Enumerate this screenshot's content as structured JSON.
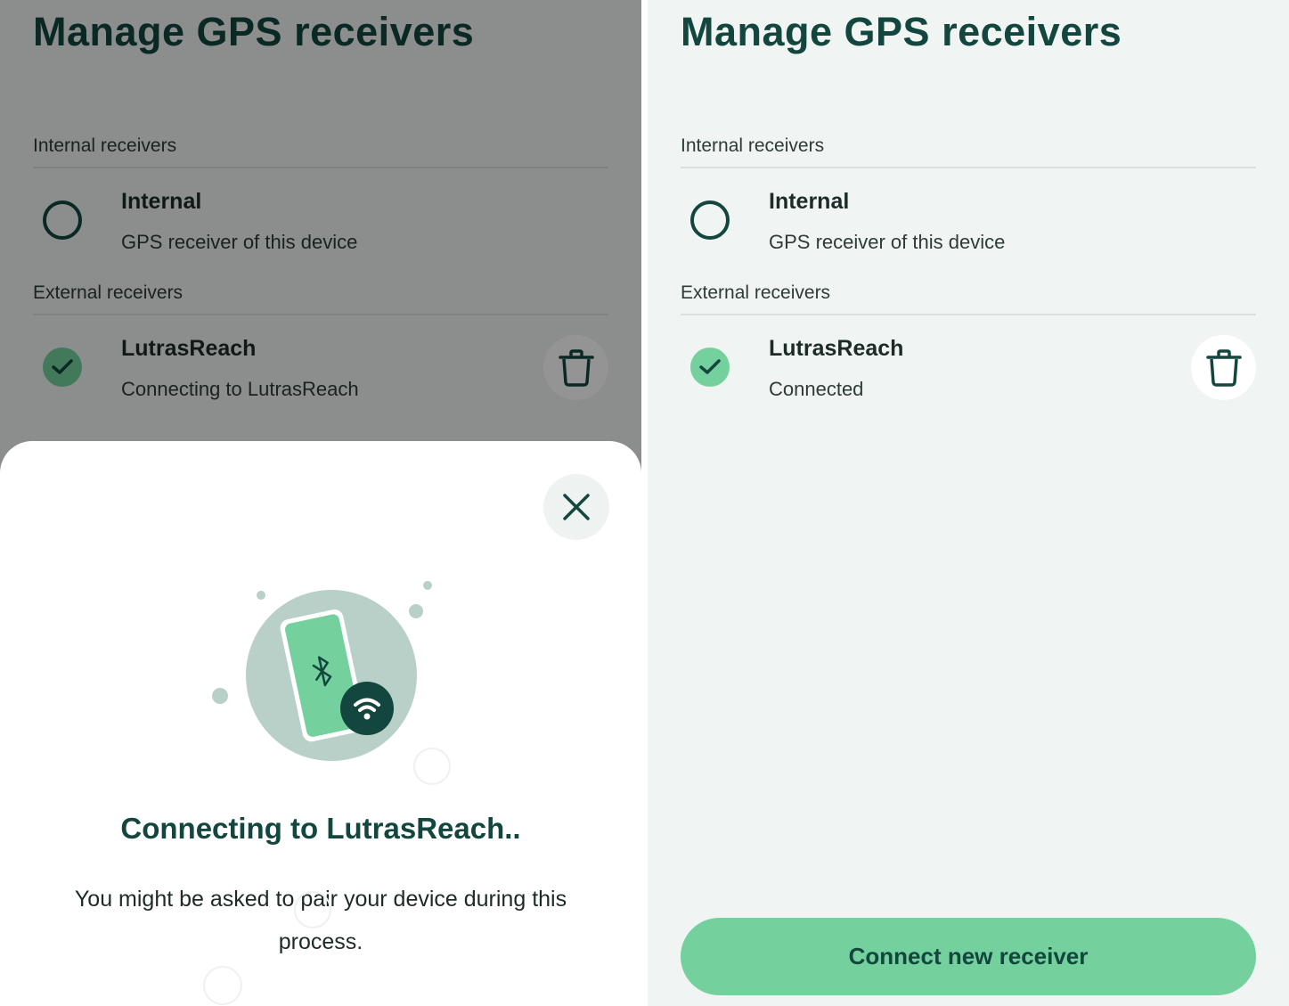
{
  "colors": {
    "primary_dark": "#12463e",
    "accent_green": "#74d19e",
    "background": "#f0f4f2"
  },
  "left_screen": {
    "title": "Manage GPS receivers",
    "internal_section_label": "Internal receivers",
    "internal_receiver": {
      "name": "Internal",
      "subtitle": "GPS receiver of this device",
      "selected": false
    },
    "external_section_label": "External receivers",
    "external_receiver": {
      "name": "LutrasReach",
      "subtitle": "Connecting to LutrasReach",
      "selected": true,
      "delete_icon": "trash-icon"
    },
    "sheet": {
      "close_icon": "close-icon",
      "illustration_icons": [
        "bluetooth-icon",
        "wifi-icon"
      ],
      "title": "Connecting to LutrasReach..",
      "body": "You might be asked to pair your device during this process."
    }
  },
  "right_screen": {
    "title": "Manage GPS receivers",
    "internal_section_label": "Internal receivers",
    "internal_receiver": {
      "name": "Internal",
      "subtitle": "GPS receiver of this device",
      "selected": false
    },
    "external_section_label": "External receivers",
    "external_receiver": {
      "name": "LutrasReach",
      "subtitle": "Connected",
      "selected": true,
      "delete_icon": "trash-icon"
    },
    "connect_button_label": "Connect new receiver"
  }
}
